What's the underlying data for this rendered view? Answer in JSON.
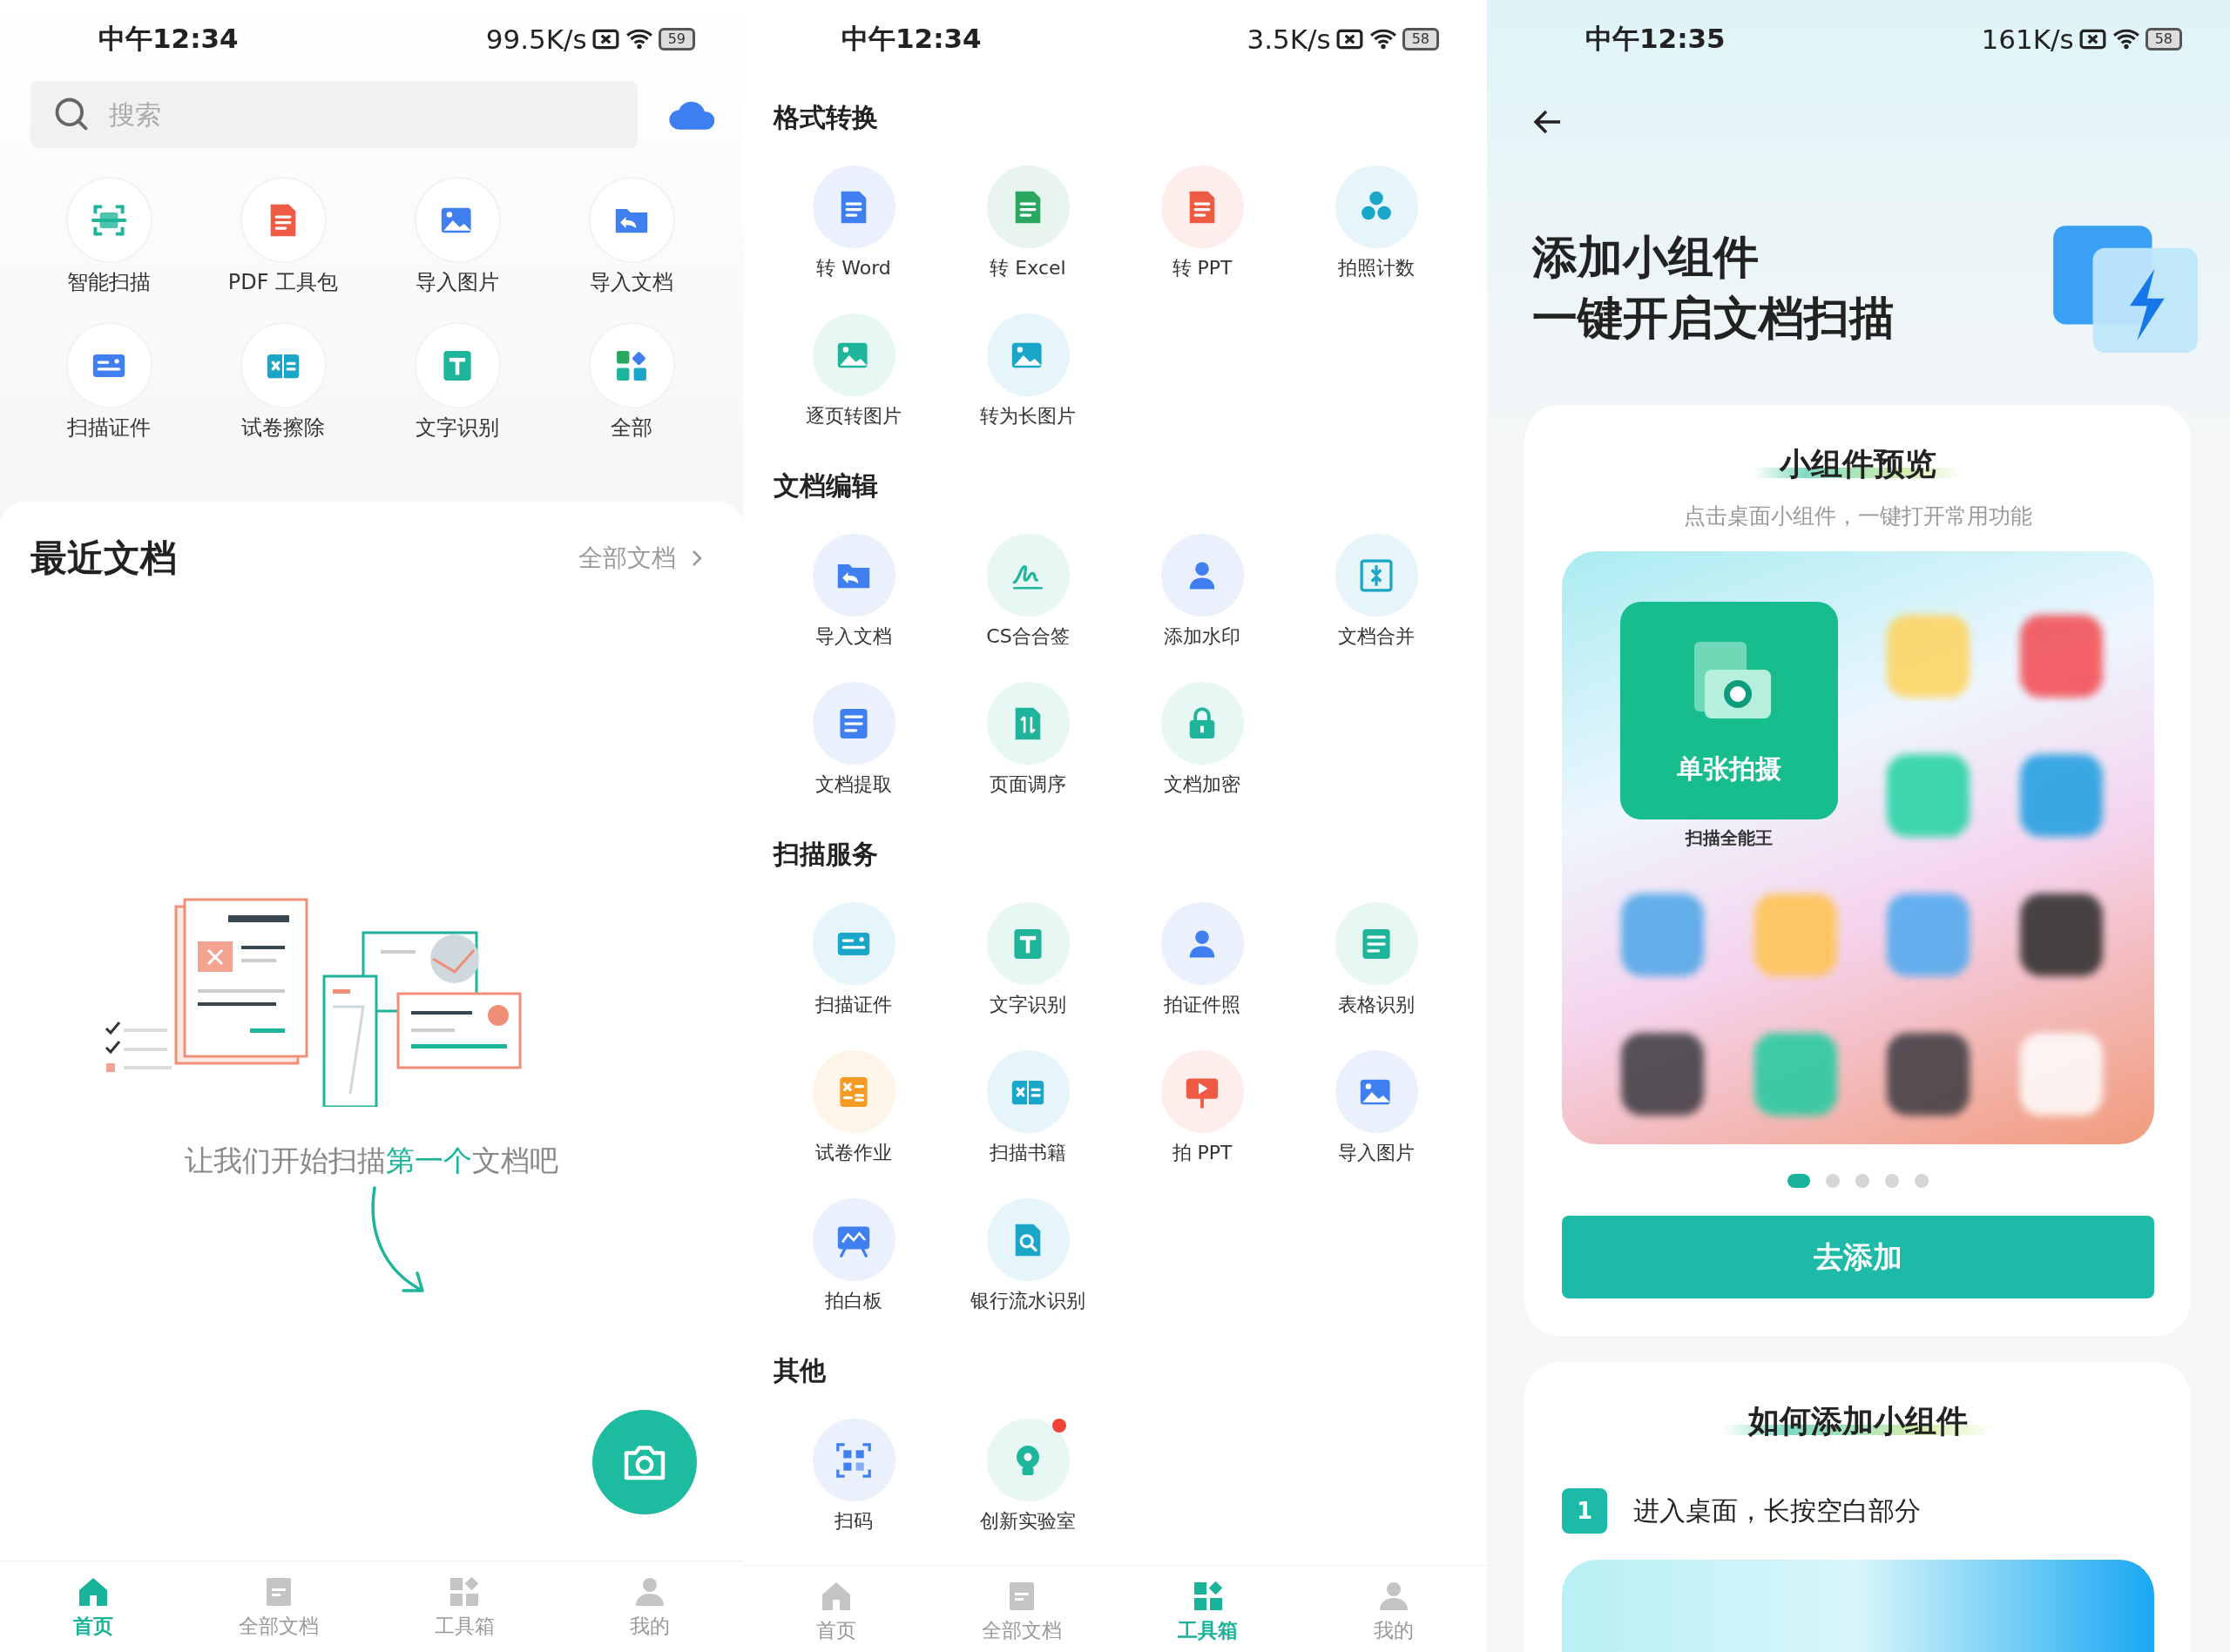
{
  "home": {
    "status": {
      "time": "中午12:34",
      "speed": "99.5K/s",
      "battery": "59"
    },
    "search": {
      "placeholder": "搜索"
    },
    "quick_tools": [
      {
        "label": "智能扫描"
      },
      {
        "label": "PDF 工具包"
      },
      {
        "label": "导入图片"
      },
      {
        "label": "导入文档"
      },
      {
        "label": "扫描证件"
      },
      {
        "label": "试卷擦除"
      },
      {
        "label": "文字识别"
      },
      {
        "label": "全部"
      }
    ],
    "recent": {
      "title": "最近文档",
      "link": "全部文档"
    },
    "empty_state": {
      "text_before": "让我们开始扫描",
      "highlight": "第一个",
      "text_after": "文档吧"
    },
    "nav": [
      {
        "label": "首页",
        "selected": true
      },
      {
        "label": "全部文档",
        "selected": false
      },
      {
        "label": "工具箱",
        "selected": false
      },
      {
        "label": "我的",
        "selected": false
      }
    ]
  },
  "toolbox": {
    "status": {
      "time": "中午12:34",
      "speed": "3.5K/s",
      "battery": "58"
    },
    "sections": [
      {
        "title": "格式转换",
        "tools": [
          {
            "label": "转 Word",
            "badge": false
          },
          {
            "label": "转 Excel",
            "badge": false
          },
          {
            "label": "转 PPT",
            "badge": false
          },
          {
            "label": "拍照计数",
            "badge": false
          },
          {
            "label": "逐页转图片",
            "badge": false
          },
          {
            "label": "转为长图片",
            "badge": false
          }
        ]
      },
      {
        "title": "文档编辑",
        "tools": [
          {
            "label": "导入文档",
            "badge": false
          },
          {
            "label": "CS合合签",
            "badge": false
          },
          {
            "label": "添加水印",
            "badge": false
          },
          {
            "label": "文档合并",
            "badge": false
          },
          {
            "label": "文档提取",
            "badge": false
          },
          {
            "label": "页面调序",
            "badge": false
          },
          {
            "label": "文档加密",
            "badge": false
          }
        ]
      },
      {
        "title": "扫描服务",
        "tools": [
          {
            "label": "扫描证件",
            "badge": false
          },
          {
            "label": "文字识别",
            "badge": false
          },
          {
            "label": "拍证件照",
            "badge": false
          },
          {
            "label": "表格识别",
            "badge": false
          },
          {
            "label": "试卷作业",
            "badge": false
          },
          {
            "label": "扫描书籍",
            "badge": false
          },
          {
            "label": "拍 PPT",
            "badge": false
          },
          {
            "label": "导入图片",
            "badge": false
          },
          {
            "label": "拍白板",
            "badge": false
          },
          {
            "label": "银行流水识别",
            "badge": false
          }
        ]
      },
      {
        "title": "其他",
        "tools": [
          {
            "label": "扫码",
            "badge": false
          },
          {
            "label": "创新实验室",
            "badge": true
          }
        ]
      }
    ],
    "nav": [
      {
        "label": "首页",
        "selected": false
      },
      {
        "label": "全部文档",
        "selected": false
      },
      {
        "label": "工具箱",
        "selected": true
      },
      {
        "label": "我的",
        "selected": false
      }
    ]
  },
  "widget": {
    "status": {
      "time": "中午12:35",
      "speed": "161K/s",
      "battery": "58"
    },
    "title_lines": [
      "添加小组件",
      "一键开启文档扫描"
    ],
    "preview": {
      "title": "小组件预览",
      "subtitle": "点击桌面小组件，一键打开常用功能",
      "widget_label": "单张拍摄",
      "app_name": "扫描全能王",
      "pager": [
        {
          "selected": true
        },
        {
          "selected": false
        },
        {
          "selected": false
        },
        {
          "selected": false
        },
        {
          "selected": false
        }
      ]
    },
    "add_button": "去添加",
    "howto": {
      "title": "如何添加小组件",
      "steps": [
        {
          "number": "1",
          "text": "进入桌面，长按空白部分"
        }
      ]
    }
  }
}
